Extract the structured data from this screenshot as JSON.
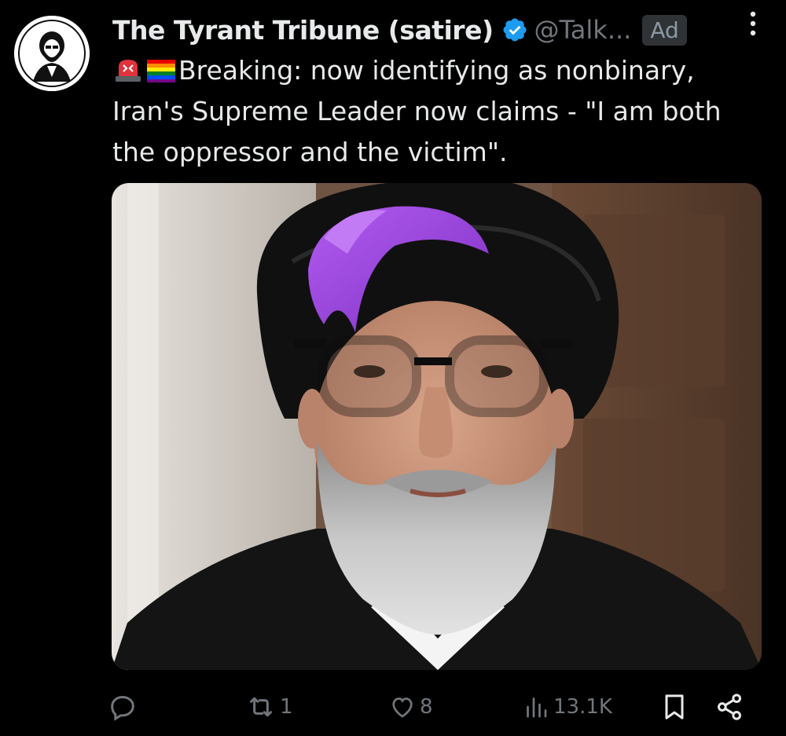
{
  "tweet": {
    "display_name": "The Tyrant Tribune (satire)",
    "handle": "@Talk...",
    "ad_label": "Ad",
    "text_lines": [
      "Breaking: now identifying as nonbinary,",
      "Iran's Supreme Leader now claims - \"I am both",
      "the oppressor and the victim\"."
    ],
    "leading_emojis": [
      "siren-emoji",
      "rainbow-flag-emoji"
    ]
  },
  "actions": {
    "reply_count": "",
    "repost_count": "1",
    "like_count": "8",
    "views_count": "13.1K"
  },
  "icons": {
    "avatar": "avatar-logo",
    "verified": "verified-badge-icon",
    "more": "more-options-icon",
    "reply": "reply-icon",
    "repost": "repost-icon",
    "like": "heart-icon",
    "views": "views-icon",
    "bookmark": "bookmark-icon",
    "share": "share-icon"
  },
  "colors": {
    "background": "#000000",
    "text_primary": "#e7e9ea",
    "text_secondary": "#71767b",
    "verified_blue": "#1d9bf0",
    "ad_badge_bg": "#2f3336"
  }
}
